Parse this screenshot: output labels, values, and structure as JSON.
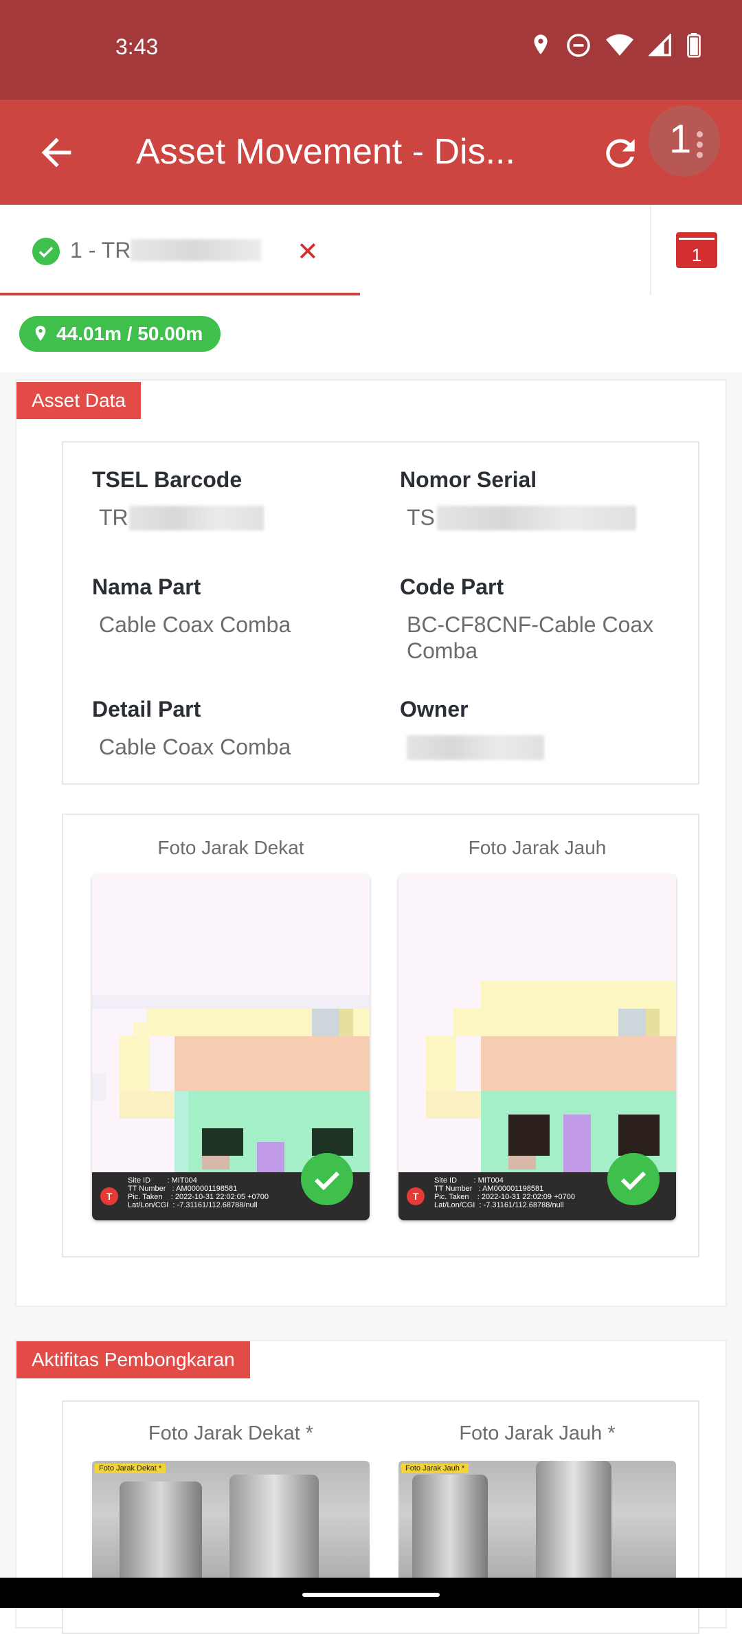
{
  "status_bar": {
    "time": "3:43",
    "icons": [
      "location-icon",
      "dnd-icon",
      "wifi-icon",
      "signal-icon",
      "battery-icon"
    ]
  },
  "app_bar": {
    "title": "Asset Movement - Dis...",
    "menu_count": "1",
    "colors": {
      "status": "#a3393a",
      "bar": "#cc4541"
    }
  },
  "tab": {
    "label": "1 - TR",
    "close": "✕",
    "calendar_day": "1"
  },
  "distance": "44.01m / 50.00m",
  "asset_data": {
    "section_label": "Asset Data",
    "fields": {
      "tsel_barcode": {
        "label": "TSEL Barcode",
        "value": "TR"
      },
      "nomor_serial": {
        "label": "Nomor Serial",
        "value": "TS"
      },
      "nama_part": {
        "label": "Nama Part",
        "value": "Cable Coax Comba"
      },
      "code_part": {
        "label": "Code Part",
        "value": "BC-CF8CNF-Cable Coax Comba"
      },
      "detail_part": {
        "label": "Detail Part",
        "value": "Cable Coax Comba"
      },
      "owner": {
        "label": "Owner",
        "value": ""
      }
    },
    "photos": [
      {
        "caption": "Foto Jarak Dekat",
        "footer": "Site ID        : MIT004\nTT Number   : AM000001198581\nPic. Taken    : 2022-10-31 22:02:05 +0700\nLat/Lon/CGI  : -7.31161/112.68788/null"
      },
      {
        "caption": "Foto Jarak Jauh",
        "footer": "Site ID        : MIT004\nTT Number   : AM000001198581\nPic. Taken    : 2022-10-31 22:02:09 +0700\nLat/Lon/CGI  : -7.31161/112.68788/null"
      }
    ]
  },
  "activity": {
    "section_label": "Aktifitas Pembongkaran",
    "photos": [
      {
        "caption": "Foto Jarak Dekat *",
        "tag": "Foto Jarak Dekat  *"
      },
      {
        "caption": "Foto Jarak Jauh *",
        "tag": "Foto Jarak Jauh  *"
      }
    ]
  }
}
